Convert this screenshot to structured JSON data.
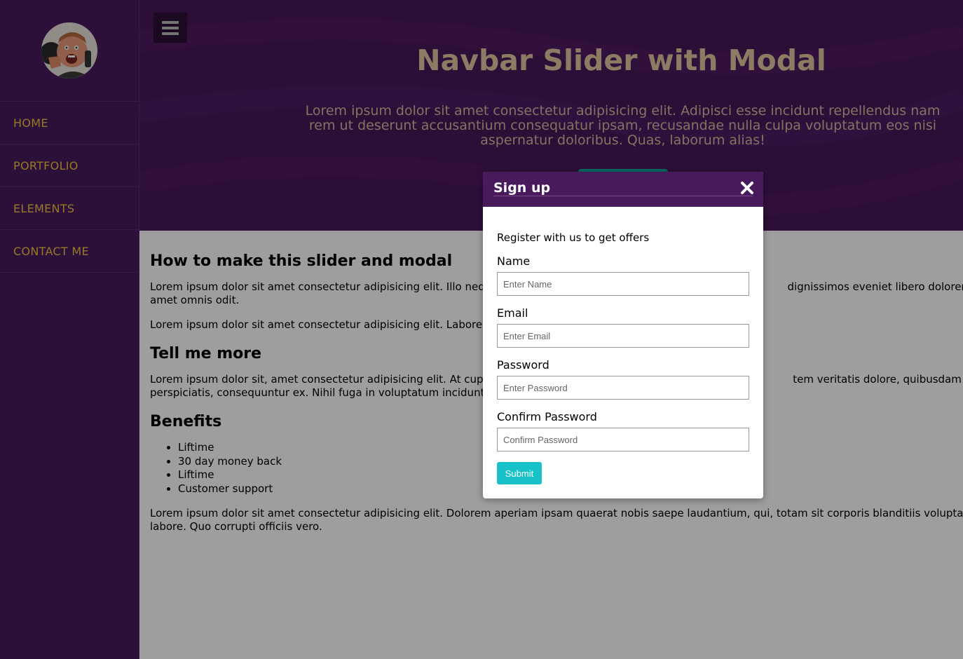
{
  "sidebar": {
    "avatar_alt": "avatar",
    "items": [
      {
        "label": "HOME"
      },
      {
        "label": "PORTFOLIO"
      },
      {
        "label": "ELEMENTS"
      },
      {
        "label": "CONTACT ME"
      }
    ]
  },
  "hero": {
    "menu_icon": "hamburger-icon",
    "title": "Navbar Slider with Modal",
    "text": "Lorem ipsum dolor sit amet consectetur adipisicing elit. Adipisci esse incidunt repellendus nam rem ut deserunt accusantium consequatur ipsam, recusandae nulla culpa voluptatum eos nisi aspernatur doloribus. Quas, laborum alias!"
  },
  "content": {
    "h1": "How to make this slider and modal",
    "p1a": "Lorem ipsum dolor sit amet consectetur adipisicing elit. Illo neque",
    "p1b": "dignissimos eveniet libero dolorem quo",
    "p1c": "amet omnis odit.",
    "p2": "Lorem ipsum dolor sit amet consectetur adipisicing elit. Labore ea",
    "h2": "Tell me more",
    "p3a": "Lorem ipsum dolor sit, amet consectetur adipisicing elit. At cupidit",
    "p3b": "tem veritatis dolore, quibusdam reprehe",
    "p3c": "perspiciatis, consequuntur ex. Nihil fuga in voluptatum incidunt!",
    "h3": "Benefits",
    "benefits": [
      "Liftime",
      "30 day money back",
      "Liftime",
      "Customer support"
    ],
    "p4a": "Lorem ipsum dolor sit amet consectetur adipisicing elit. Dolorem aperiam ipsam quaerat nobis saepe laudantium, qui, totam sit corporis blanditiis voluptatibus m",
    "p4b": "labore. Quo corrupti officiis vero."
  },
  "modal": {
    "title": "Sign up",
    "close_icon": "close-icon",
    "intro": "Register with us to get offers",
    "name_label": "Name",
    "name_placeholder": "Enter Name",
    "email_label": "Email",
    "email_placeholder": "Enter Email",
    "password_label": "Password",
    "password_placeholder": "Enter Password",
    "confirm_label": "Confirm Password",
    "confirm_placeholder": "Confirm Password",
    "submit_label": "Submit"
  },
  "colors": {
    "sidebar_bg": "#4a1a5e",
    "nav_text": "#f0c43c",
    "hero_bg": "#4a1859",
    "modal_header": "#48195b",
    "submit": "#16c2c8"
  }
}
